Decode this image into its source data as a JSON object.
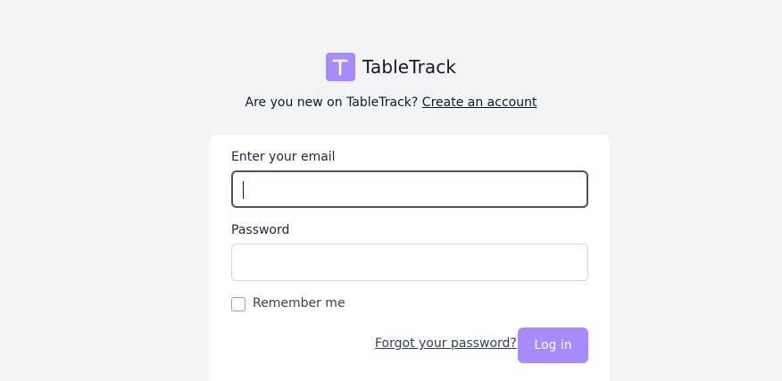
{
  "brand": {
    "logo_letter": "T",
    "app_name": "TableTrack",
    "accent_color": "#a78bfa"
  },
  "signup": {
    "prompt": "Are you new on TableTrack?",
    "link_label": "Create an account"
  },
  "login_form": {
    "email_label": "Enter your email",
    "email_value": "",
    "password_label": "Password",
    "password_value": "",
    "remember_label": "Remember me",
    "remember_checked": false,
    "forgot_label": "Forgot your password?",
    "submit_label": "Log in"
  }
}
